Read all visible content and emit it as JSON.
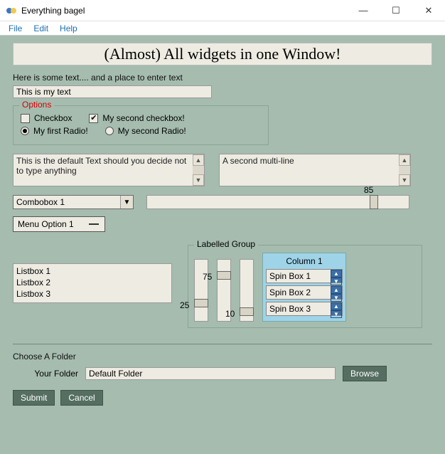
{
  "window": {
    "title": "Everything bagel",
    "minimize": "—",
    "maximize": "☐",
    "close": "✕"
  },
  "menubar": {
    "file": "File",
    "edit": "Edit",
    "help": "Help"
  },
  "heading": "(Almost) All widgets in one Window!",
  "intro_label": "Here is some text....  and a place to enter text",
  "text_input_value": "This is my text",
  "options": {
    "legend": "Options",
    "checkbox1": "Checkbox",
    "checkbox1_checked": false,
    "checkbox2": "My second checkbox!",
    "checkbox2_checked": true,
    "radio1": "My first Radio!",
    "radio1_selected": true,
    "radio2": "My second Radio!",
    "radio2_selected": false
  },
  "multiline1": "This is the default Text should you decide not to type anything",
  "multiline2": "A second multi-line",
  "combobox": {
    "value": "Combobox 1"
  },
  "hslider": {
    "value": 85
  },
  "menubutton": "Menu Option 1",
  "listbox": [
    "Listbox 1",
    "Listbox 2",
    "Listbox 3"
  ],
  "labelled_group": {
    "legend": "Labelled Group",
    "vslider1": 25,
    "vslider2": 75,
    "vslider3": 10,
    "column1_title": "Column 1",
    "spin1": "Spin Box 1",
    "spin2": "Spin Box 2",
    "spin3": "Spin Box 3"
  },
  "folder": {
    "section_label": "Choose A Folder",
    "label": "Your Folder",
    "value": "Default Folder",
    "browse": "Browse"
  },
  "buttons": {
    "submit": "Submit",
    "cancel": "Cancel"
  }
}
